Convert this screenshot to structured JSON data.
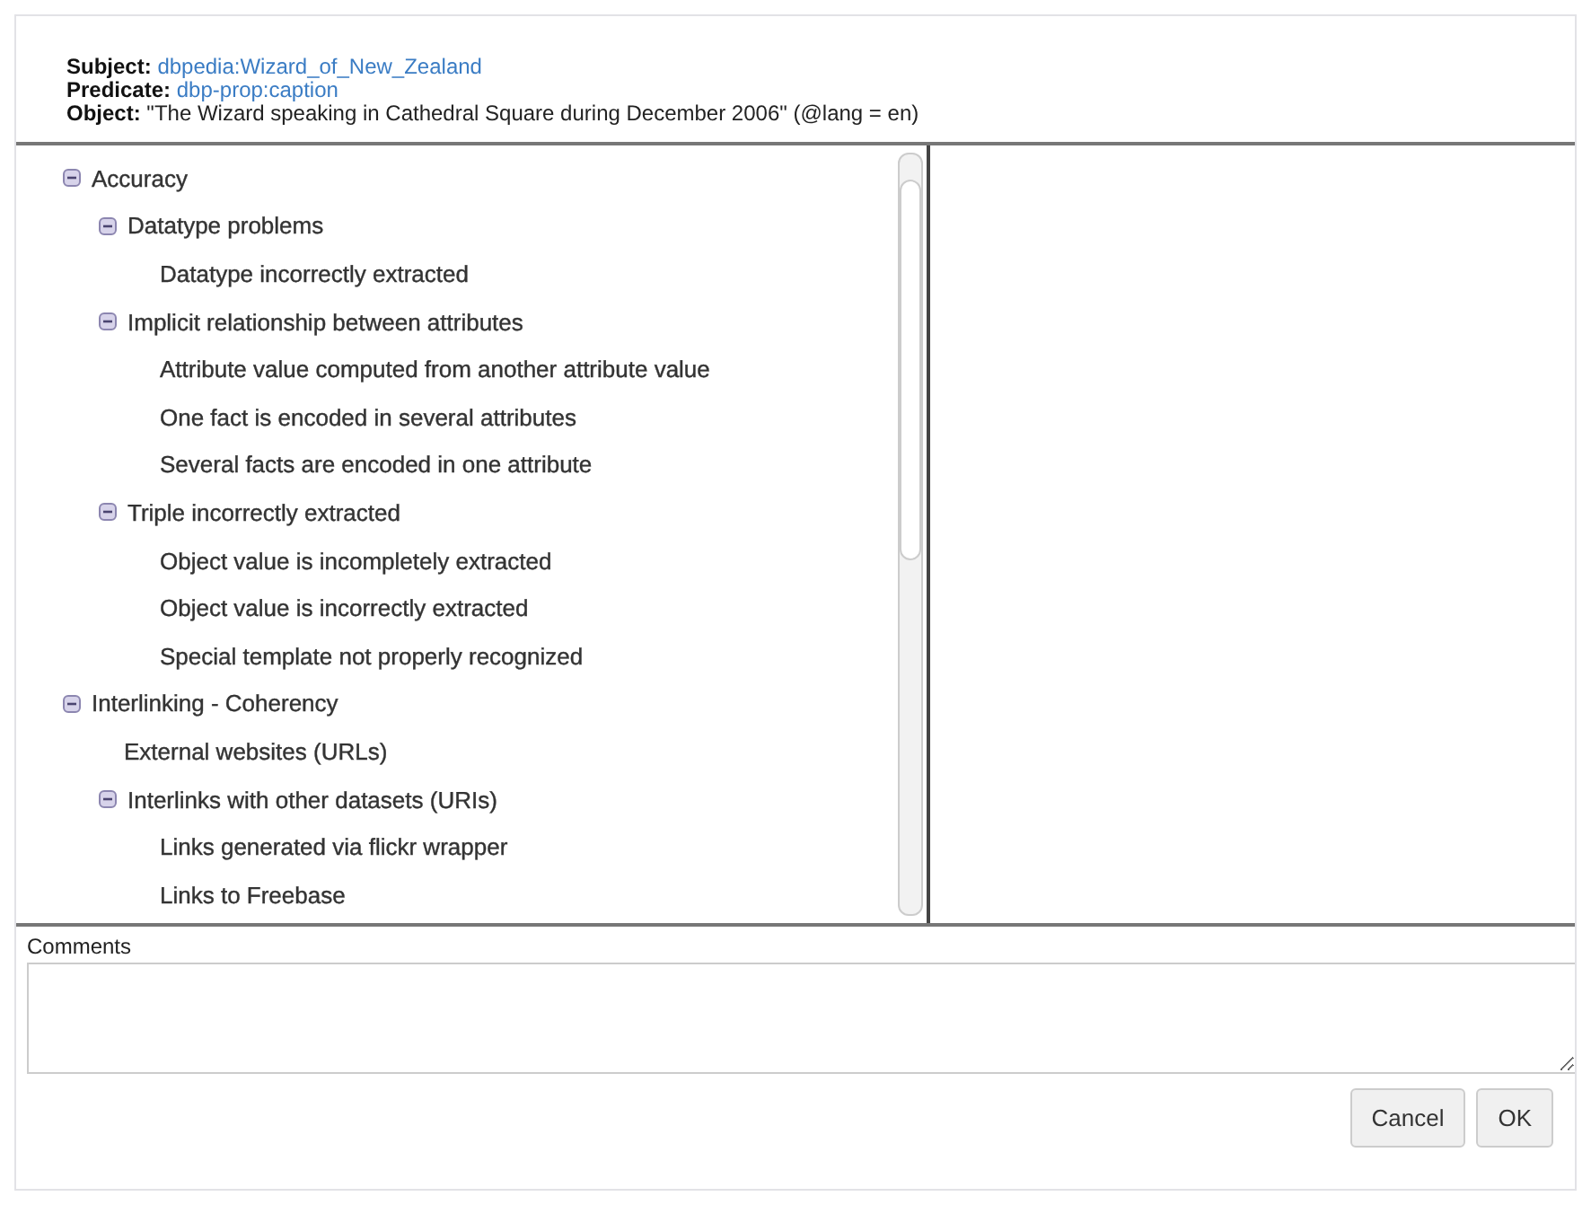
{
  "header": {
    "subject_label": "Subject:",
    "subject": "dbpedia:Wizard_of_New_Zealand",
    "predicate_label": "Predicate:",
    "predicate": "dbp-prop:caption",
    "object_label": "Object:",
    "object": "\"The Wizard speaking in Cathedral Square during December 2006\" (@lang = en)"
  },
  "tree": [
    {
      "label": "Accuracy",
      "expanded": true,
      "children": [
        {
          "label": "Datatype problems",
          "expanded": true,
          "children": [
            {
              "label": "Datatype incorrectly extracted"
            }
          ]
        },
        {
          "label": "Implicit relationship between attributes",
          "expanded": true,
          "children": [
            {
              "label": "Attribute value computed from another attribute value"
            },
            {
              "label": "One fact is encoded in several attributes"
            },
            {
              "label": "Several facts are encoded in one attribute"
            }
          ]
        },
        {
          "label": "Triple incorrectly extracted",
          "expanded": true,
          "children": [
            {
              "label": "Object value is incompletely extracted"
            },
            {
              "label": "Object value is incorrectly extracted"
            },
            {
              "label": "Special template not properly recognized"
            }
          ]
        }
      ]
    },
    {
      "label": "Interlinking - Coherency",
      "expanded": true,
      "children": [
        {
          "label": "External websites (URLs)"
        },
        {
          "label": "Interlinks with other datasets (URIs)",
          "expanded": true,
          "children": [
            {
              "label": "Links generated via flickr wrapper"
            },
            {
              "label": "Links to Freebase"
            }
          ]
        }
      ]
    }
  ],
  "comments": {
    "label": "Comments"
  },
  "buttons": [
    "Cancel",
    "OK"
  ]
}
